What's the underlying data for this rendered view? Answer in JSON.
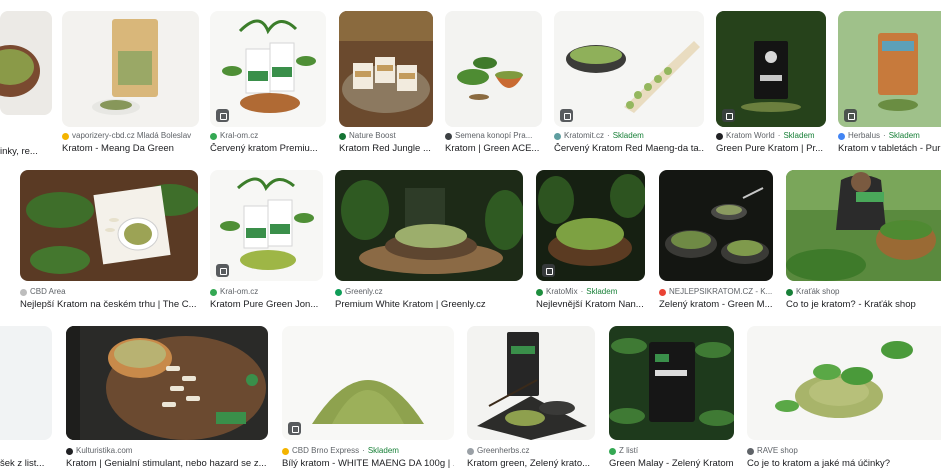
{
  "stock_label": "Skladem",
  "colors": {
    "stock": "#188038"
  },
  "results": [
    {
      "source": "",
      "title": "inky, re...",
      "in_stock": false,
      "fav": "#9aa0a6"
    },
    {
      "source": "vaporizery-cbd.cz Mladá Boleslav",
      "title": "Kratom - Meang Da Green",
      "in_stock": false,
      "fav": "#f4b400"
    },
    {
      "source": "Kral-om.cz",
      "title": "Červený kratom Premiu...",
      "in_stock": false,
      "fav": "#34a853"
    },
    {
      "source": "Nature Boost",
      "title": "Kratom Red Jungle ...",
      "in_stock": false,
      "fav": "#137333"
    },
    {
      "source": "Semena konopí Pra...",
      "title": "Kratom | Green ACE...",
      "in_stock": false,
      "fav": "#3c4043"
    },
    {
      "source": "Kratomit.cz",
      "title": "Červený Kratom Red Maeng-da ta...",
      "in_stock": true,
      "fav": "#5f9ea0"
    },
    {
      "source": "Kratom World",
      "title": "Green Pure Kratom | Pr...",
      "in_stock": true,
      "fav": "#202124"
    },
    {
      "source": "Herbalus",
      "title": "Kratom v tabletách - Pur",
      "in_stock": true,
      "fav": "#4285f4"
    },
    {
      "source": "CBD Area",
      "title": "Nejlepší Kratom na českém trhu | The C...",
      "in_stock": false,
      "fav": "#bdbdbd"
    },
    {
      "source": "Kral-om.cz",
      "title": "Kratom Pure Green Jon...",
      "in_stock": false,
      "fav": "#34a853"
    },
    {
      "source": "Greenly.cz",
      "title": "Premium White Kratom | Greenly.cz",
      "in_stock": false,
      "fav": "#0f9d58"
    },
    {
      "source": "KratoMix",
      "title": "Nejlevnější Kratom Nan...",
      "in_stock": true,
      "fav": "#1e8e3e"
    },
    {
      "source": "NEJLEPSIKRATOM.CZ - K...",
      "title": "Zelený kratom - Green M...",
      "in_stock": false,
      "fav": "#ea4335"
    },
    {
      "source": "Kraťák shop",
      "title": "Co to je kratom? - Kraťák shop",
      "in_stock": false,
      "fav": "#188038"
    },
    {
      "source": "",
      "title": "šek z list...",
      "in_stock": false,
      "fav": "#9aa0a6"
    },
    {
      "source": "Kulturistika.com",
      "title": "Kratom | Genialní stimulant, nebo hazard se z...",
      "in_stock": false,
      "fav": "#202124"
    },
    {
      "source": "CBD Brno Express",
      "title": "Bílý kratom - WHITE MAENG DA 100g | ...",
      "in_stock": true,
      "fav": "#f4b400"
    },
    {
      "source": "Greenherbs.cz",
      "title": "Kratom green, Zelený krato...",
      "in_stock": false,
      "fav": "#9aa0a6"
    },
    {
      "source": "Z listí",
      "title": "Green Malay - Zelený Kratom",
      "in_stock": false,
      "fav": "#34a853"
    },
    {
      "source": "RAVE shop",
      "title": "Co je to kratom a jaké má účinky?",
      "in_stock": false,
      "fav": "#5f6368"
    }
  ]
}
